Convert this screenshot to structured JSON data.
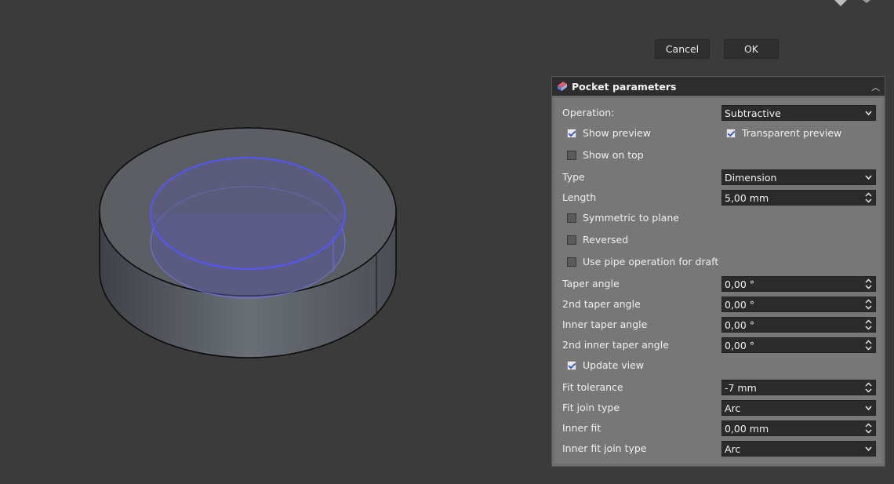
{
  "buttons": {
    "cancel": "Cancel",
    "ok": "OK"
  },
  "panel": {
    "title": "Pocket parameters",
    "operation": {
      "label": "Operation:",
      "value": "Subtractive"
    },
    "show_preview": {
      "label": "Show preview",
      "checked": true
    },
    "transparent_preview": {
      "label": "Transparent preview",
      "checked": true
    },
    "show_on_top": {
      "label": "Show on top",
      "checked": false
    },
    "type": {
      "label": "Type",
      "value": "Dimension"
    },
    "length": {
      "label": "Length",
      "value": "5,00 mm"
    },
    "symmetric": {
      "label": "Symmetric to plane",
      "checked": false
    },
    "reversed": {
      "label": "Reversed",
      "checked": false
    },
    "pipe_draft": {
      "label": "Use pipe operation for draft",
      "checked": false
    },
    "taper_angle": {
      "label": "Taper angle",
      "value": "0,00 °"
    },
    "taper_angle2": {
      "label": "2nd taper angle",
      "value": "0,00 °"
    },
    "inner_taper": {
      "label": "Inner taper angle",
      "value": "0,00 °"
    },
    "inner_taper2": {
      "label": "2nd inner taper angle",
      "value": "0,00 °"
    },
    "update_view": {
      "label": "Update view",
      "checked": true
    },
    "fit_tolerance": {
      "label": "Fit tolerance",
      "value": "-7 mm"
    },
    "fit_join": {
      "label": "Fit join type",
      "value": "Arc"
    },
    "inner_fit": {
      "label": "Inner fit",
      "value": "0,00 mm"
    },
    "inner_fit_join": {
      "label": "Inner fit join type",
      "value": "Arc"
    }
  }
}
